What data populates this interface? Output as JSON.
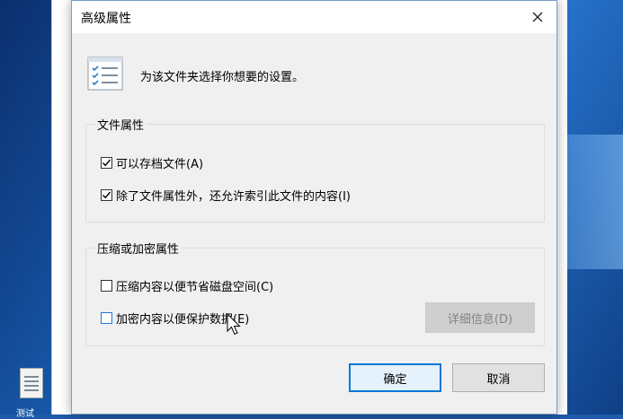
{
  "dialog": {
    "title": "高级属性",
    "header_text": "为该文件夹选择你想要的设置。",
    "file_attributes": {
      "group_label": "文件属性",
      "archive_label": "可以存档文件(A)",
      "archive_checked": true,
      "index_label": "除了文件属性外，还允许索引此文件的内容(I)",
      "index_checked": true
    },
    "compress_encrypt": {
      "group_label": "压缩或加密属性",
      "compress_label": "压缩内容以便节省磁盘空间(C)",
      "compress_checked": false,
      "encrypt_label": "加密内容以便保护数据(E)",
      "encrypt_checked": false,
      "details_label": "详细信息(D)",
      "details_enabled": false
    },
    "ok_label": "确定",
    "cancel_label": "取消"
  },
  "background": {
    "desktop_icon_label": "测试"
  },
  "icons": {
    "close": "close-icon",
    "header": "checklist-icon",
    "cursor": "mouse-pointer-icon"
  }
}
